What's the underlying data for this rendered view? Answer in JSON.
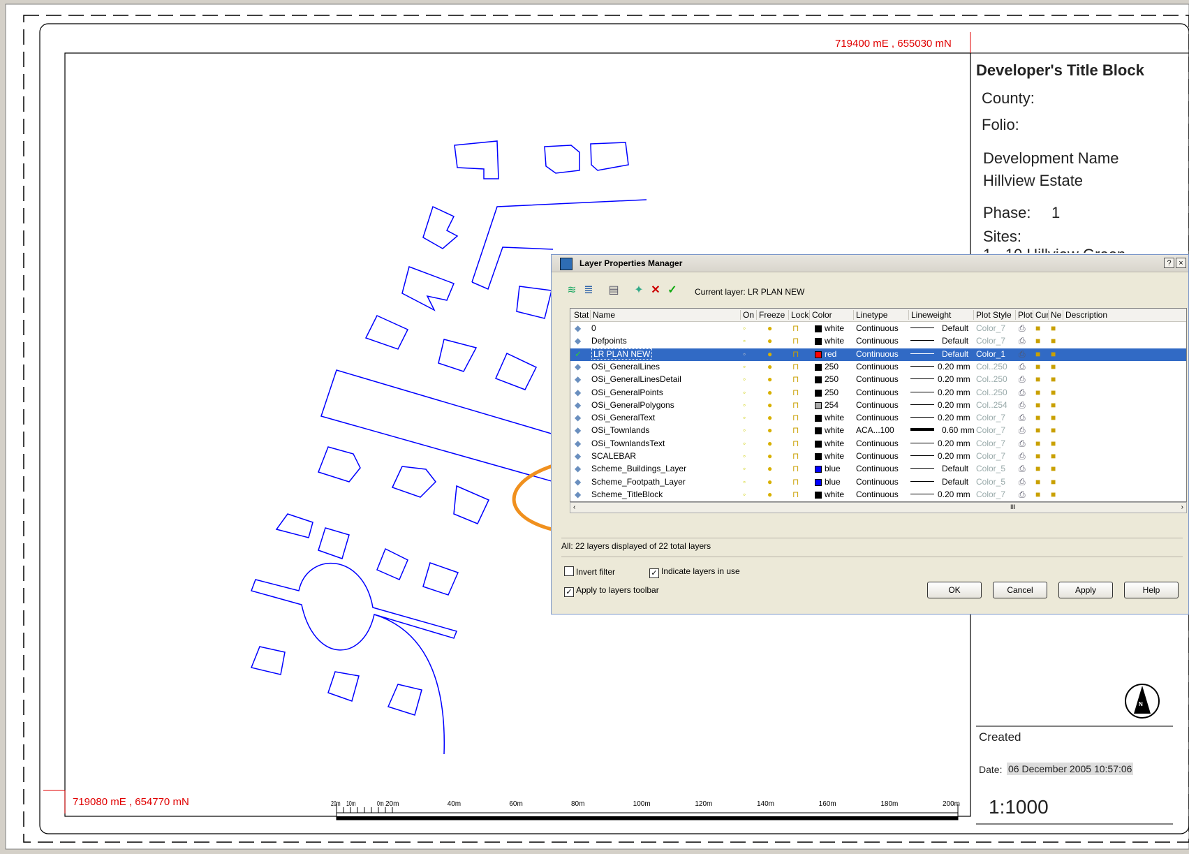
{
  "drawing": {
    "coord_top": "719400 mE , 655030 mN",
    "coord_bottom": "719080 mE , 654770 mN",
    "scale_labels": [
      "20m",
      "10m",
      "0m",
      "20m",
      "40m",
      "60m",
      "80m",
      "100m",
      "120m",
      "140m",
      "160m",
      "180m",
      "200m"
    ],
    "linework_color": "#0000ff",
    "coord_color": "#e00000"
  },
  "title_block": {
    "heading": "Developer's Title Block",
    "county": "County:",
    "folio": "Folio:",
    "dev_name_label": "Development Name",
    "dev_name_value": "Hillview Estate",
    "phase_label": "Phase:",
    "phase_value": "1",
    "sites_label": "Sites:",
    "sites_value": "1 - 10 Hillview Green",
    "created": "Created",
    "date_label": "Date:",
    "date_value": "06 December 2005 10:57:06",
    "scale": "1:1000",
    "north_letter": "N"
  },
  "dialog": {
    "title": "Layer Properties Manager",
    "help_btn": "?",
    "close_btn": "×",
    "current_layer": "Current layer: LR PLAN NEW",
    "columns": [
      "Stat",
      "Name",
      "On",
      "Freeze",
      "Lock",
      "Color",
      "Linetype",
      "Lineweight",
      "Plot Style",
      "Plot",
      "Cur",
      "Ne",
      "Description"
    ],
    "rows": [
      {
        "name": "0",
        "color": "white",
        "swatch": "#000000",
        "linetype": "Continuous",
        "lineweight": "Default",
        "plotstyle": "Color_7",
        "selected": false,
        "current": false
      },
      {
        "name": "Defpoints",
        "color": "white",
        "swatch": "#000000",
        "linetype": "Continuous",
        "lineweight": "Default",
        "plotstyle": "Color_7",
        "selected": false,
        "current": false
      },
      {
        "name": "LR PLAN NEW",
        "color": "red",
        "swatch": "#ff0000",
        "linetype": "Continuous",
        "lineweight": "Default",
        "plotstyle": "Color_1",
        "selected": true,
        "current": true
      },
      {
        "name": "OSi_GeneralLines",
        "color": "250",
        "swatch": "#000000",
        "linetype": "Continuous",
        "lineweight": "0.20 mm",
        "plotstyle": "Col..250",
        "selected": false,
        "current": false
      },
      {
        "name": "OSi_GeneralLinesDetail",
        "color": "250",
        "swatch": "#000000",
        "linetype": "Continuous",
        "lineweight": "0.20 mm",
        "plotstyle": "Col..250",
        "selected": false,
        "current": false
      },
      {
        "name": "OSi_GeneralPoints",
        "color": "250",
        "swatch": "#000000",
        "linetype": "Continuous",
        "lineweight": "0.20 mm",
        "plotstyle": "Col..250",
        "selected": false,
        "current": false
      },
      {
        "name": "OSi_GeneralPolygons",
        "color": "254",
        "swatch": "#aaaaaa",
        "linetype": "Continuous",
        "lineweight": "0.20 mm",
        "plotstyle": "Col..254",
        "selected": false,
        "current": false
      },
      {
        "name": "OSi_GeneralText",
        "color": "white",
        "swatch": "#000000",
        "linetype": "Continuous",
        "lineweight": "0.20 mm",
        "plotstyle": "Color_7",
        "selected": false,
        "current": false
      },
      {
        "name": "OSi_Townlands",
        "color": "white",
        "swatch": "#000000",
        "linetype": "ACA...100",
        "lineweight": "0.60 mm",
        "plotstyle": "Color_7",
        "selected": false,
        "current": false
      },
      {
        "name": "OSi_TownlandsText",
        "color": "white",
        "swatch": "#000000",
        "linetype": "Continuous",
        "lineweight": "0.20 mm",
        "plotstyle": "Color_7",
        "selected": false,
        "current": false
      },
      {
        "name": "SCALEBAR",
        "color": "white",
        "swatch": "#000000",
        "linetype": "Continuous",
        "lineweight": "0.20 mm",
        "plotstyle": "Color_7",
        "selected": false,
        "current": false
      },
      {
        "name": "Scheme_Buildings_Layer",
        "color": "blue",
        "swatch": "#0000ff",
        "linetype": "Continuous",
        "lineweight": "Default",
        "plotstyle": "Color_5",
        "selected": false,
        "current": false
      },
      {
        "name": "Scheme_Footpath_Layer",
        "color": "blue",
        "swatch": "#0000ff",
        "linetype": "Continuous",
        "lineweight": "Default",
        "plotstyle": "Color_5",
        "selected": false,
        "current": false
      },
      {
        "name": "Scheme_TitleBlock",
        "color": "white",
        "swatch": "#000000",
        "linetype": "Continuous",
        "lineweight": "0.20 mm",
        "plotstyle": "Color_7",
        "selected": false,
        "current": false
      }
    ],
    "status": "All: 22 layers displayed of 22 total layers",
    "invert_filter": "Invert filter",
    "indicate_layers": "Indicate layers in use",
    "apply_toolbar": "Apply to layers toolbar",
    "btn_ok": "OK",
    "btn_cancel": "Cancel",
    "btn_apply": "Apply",
    "btn_help": "Help",
    "scroll_mark": "III"
  },
  "annotation_color": "#f0901e"
}
